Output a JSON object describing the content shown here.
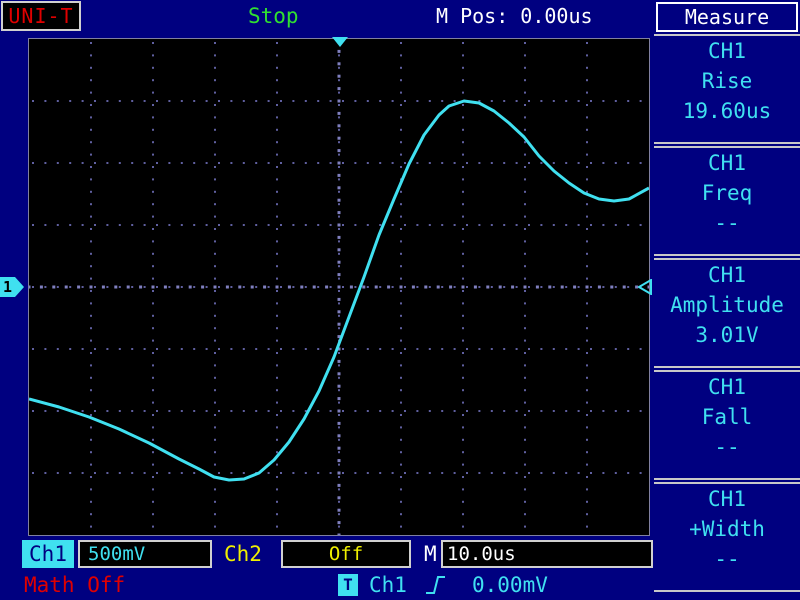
{
  "header": {
    "brand": "UNI-T",
    "status": "Stop",
    "mpos": "M Pos: 0.00us"
  },
  "colors": {
    "background": "#000080",
    "trace": "#40e0f0",
    "status": "#30e030",
    "brand": "#e00000",
    "ch2": "#f0f000"
  },
  "markers": {
    "channel_marker": "1",
    "icons": [
      "trigger-position-arrow-icon",
      "channel-1-ground-marker-icon",
      "trigger-level-arrow-icon",
      "rising-edge-icon"
    ]
  },
  "sidebar": {
    "title": "Measure",
    "items": [
      {
        "source": "CH1",
        "type": "Rise",
        "value": "19.60us"
      },
      {
        "source": "CH1",
        "type": "Freq",
        "value": "--"
      },
      {
        "source": "CH1",
        "type": "Amplitude",
        "value": "3.01V"
      },
      {
        "source": "CH1",
        "type": "Fall",
        "value": "--"
      },
      {
        "source": "CH1",
        "type": "+Width",
        "value": "--"
      }
    ]
  },
  "bottom": {
    "ch1_label": "Ch1",
    "ch1_scale": "500mV",
    "ch2_label": "Ch2",
    "ch2_state": "Off",
    "m_label": "M",
    "timebase": "10.0us",
    "math": "Math Off",
    "trigger_tag": "T",
    "trigger_source": "Ch1",
    "trigger_level": "0.00mV"
  }
}
